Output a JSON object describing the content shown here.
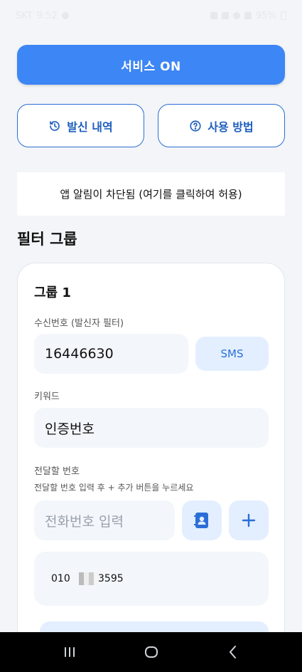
{
  "status_bar": {
    "carrier": "SKT",
    "time": "9:52",
    "battery": "95%"
  },
  "actions": {
    "service_label": "서비스 ON",
    "history_label": "발신 내역",
    "help_label": "사용 방법"
  },
  "notice": {
    "text": "앱 알림이 차단됨 (여기를 클릭하여 허용)"
  },
  "filter": {
    "section_title": "필터 그룹",
    "group": {
      "title": "그룹 1",
      "sender_label": "수신번호 (발신자 필터)",
      "sender_value": "16446630",
      "sms_label": "SMS",
      "keyword_label": "키워드",
      "keyword_value": "인증번호",
      "forward_label": "전달할 번호",
      "forward_hint": "전달할 번호 입력 후 + 추가 버튼을 누르세요",
      "phone_placeholder": "전화번호 입력",
      "saved_number_prefix": "010",
      "saved_number_suffix": "3595"
    }
  },
  "icons": {
    "history": "history-icon",
    "help": "help-circle-icon",
    "contacts": "contact-book-icon",
    "add": "plus-icon"
  },
  "colors": {
    "accent": "#3d86f5",
    "accent_light": "#e3efff",
    "outline": "#2b6fd6"
  }
}
